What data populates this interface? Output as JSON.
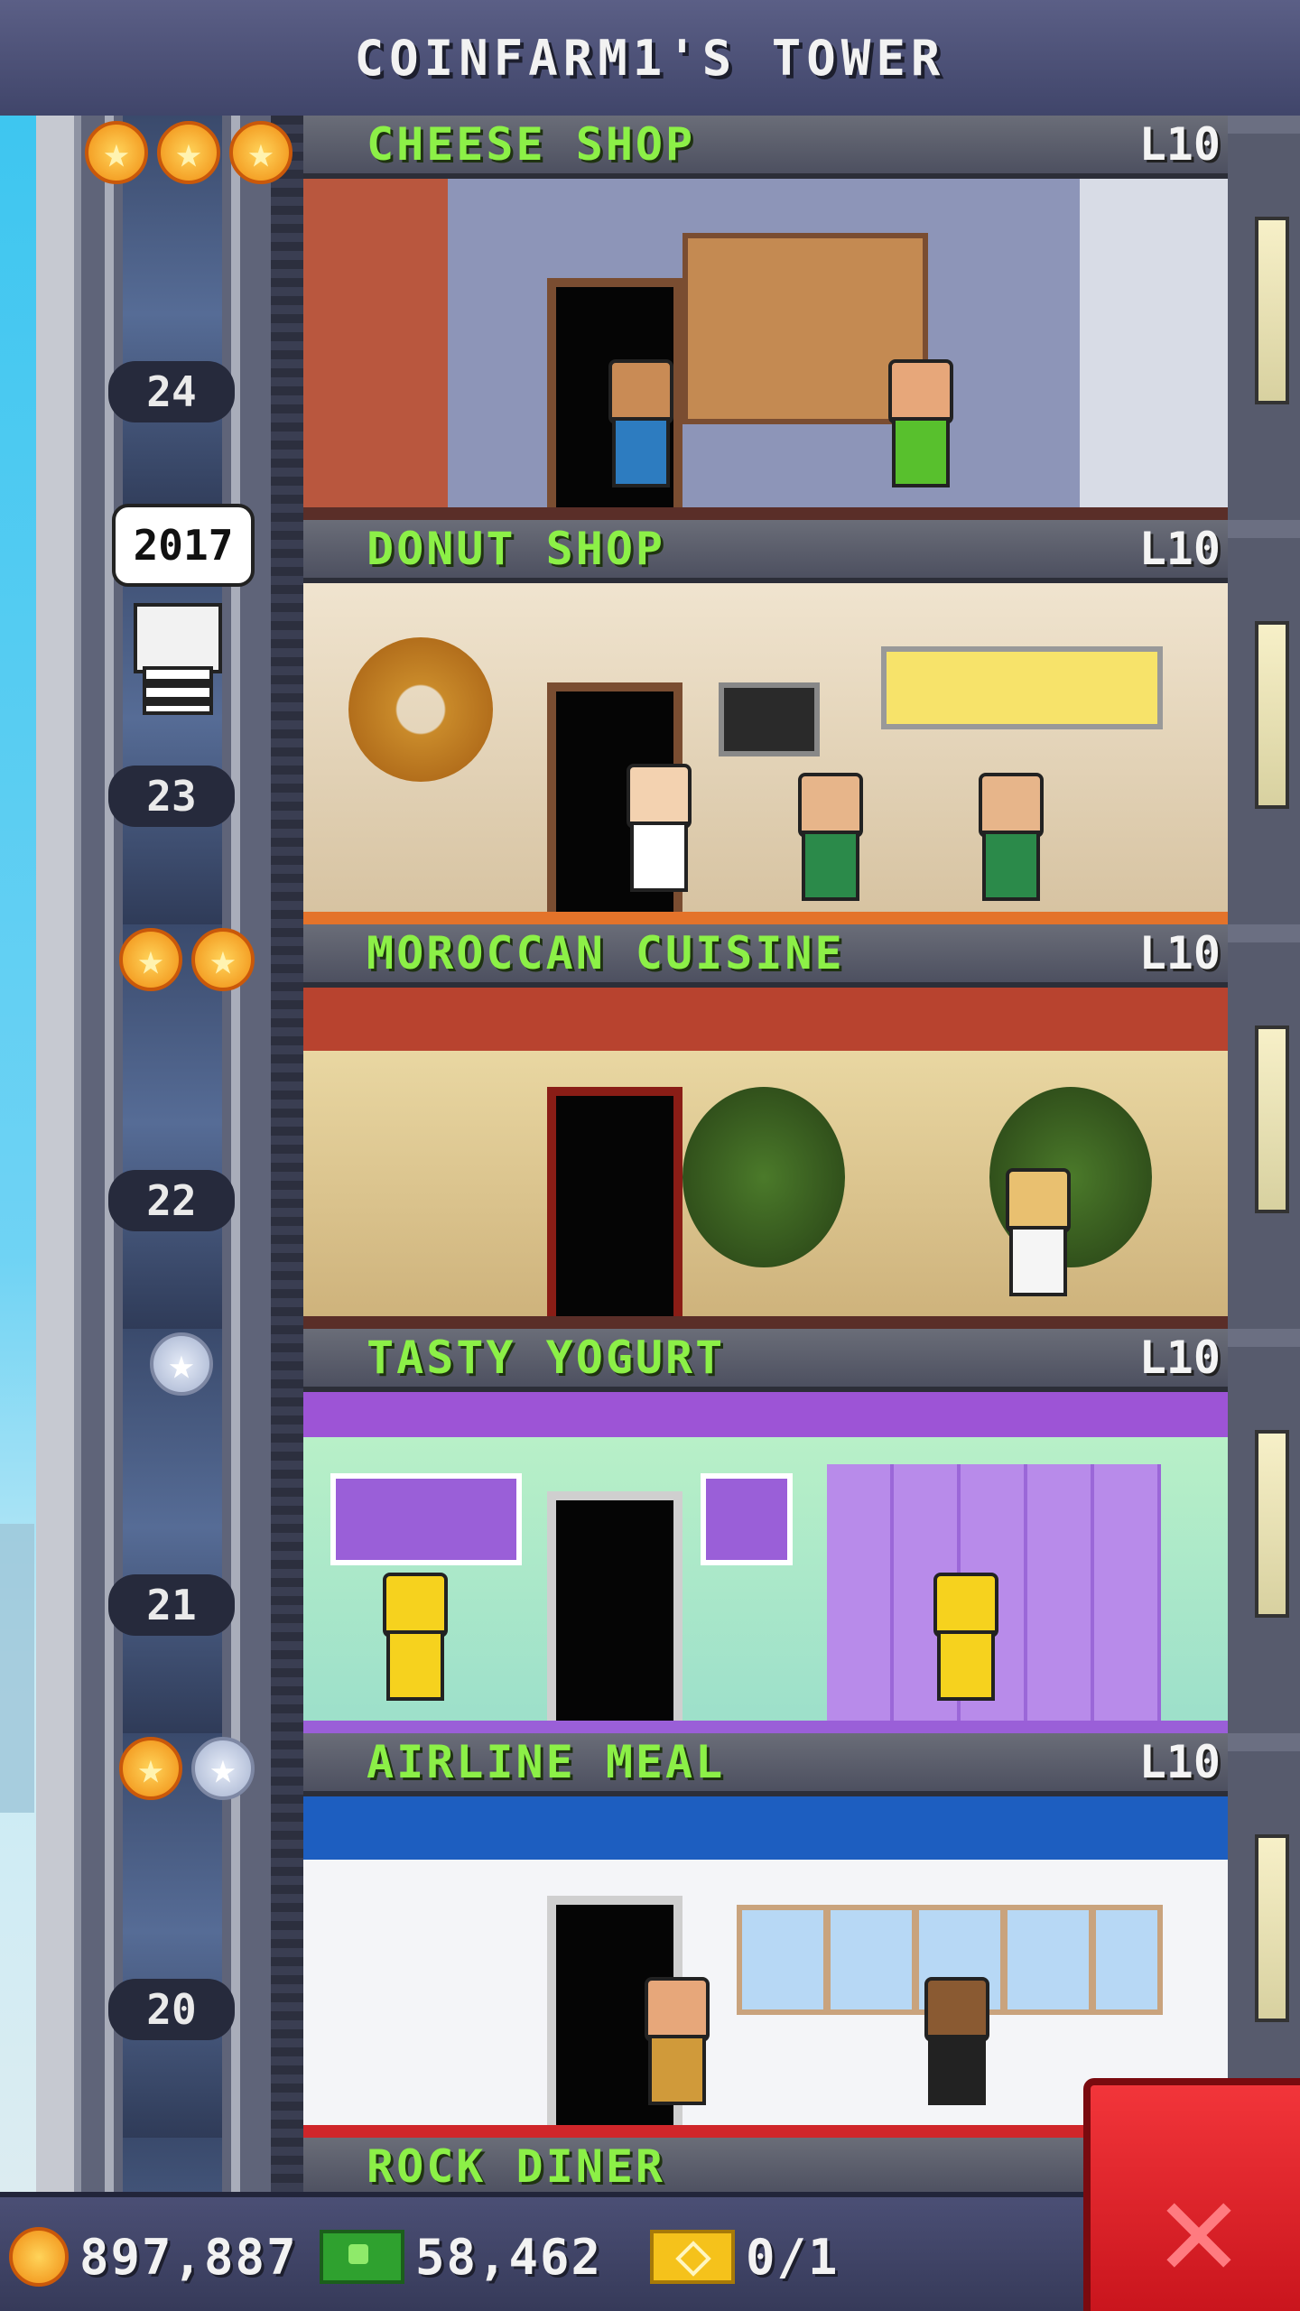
{
  "title": "COINFARM1'S TOWER",
  "elevator": {
    "floor_numbers": [
      "24",
      "23",
      "22",
      "21",
      "20"
    ],
    "speech_bubble": "2017"
  },
  "floors": [
    {
      "name": "CHEESE SHOP",
      "level": "L10",
      "theme": "cheese"
    },
    {
      "name": "DONUT SHOP",
      "level": "L10",
      "theme": "donut"
    },
    {
      "name": "MOROCCAN CUISINE",
      "level": "L10",
      "theme": "moroccan"
    },
    {
      "name": "TASTY YOGURT",
      "level": "L10",
      "theme": "yogurt"
    },
    {
      "name": "AIRLINE MEAL",
      "level": "L10",
      "theme": "airline"
    },
    {
      "name": "ROCK DINER",
      "level": "",
      "theme": "diner"
    }
  ],
  "stars": [
    {
      "gold": 3,
      "silver": 0
    },
    {
      "gold": 2,
      "silver": 0
    },
    {
      "gold": 0,
      "silver": 1
    },
    {
      "gold": 1,
      "silver": 1
    }
  ],
  "status_bar": {
    "coins": "897,887",
    "bux": "58,462",
    "tickets": "0/1"
  },
  "colors": {
    "floor_name": "#8cf047",
    "close_button": "#e8262d",
    "title_bar": "#4a4e74"
  },
  "icons": [
    "coin-icon",
    "bux-icon",
    "ticket-icon",
    "close-icon",
    "star-icon"
  ]
}
